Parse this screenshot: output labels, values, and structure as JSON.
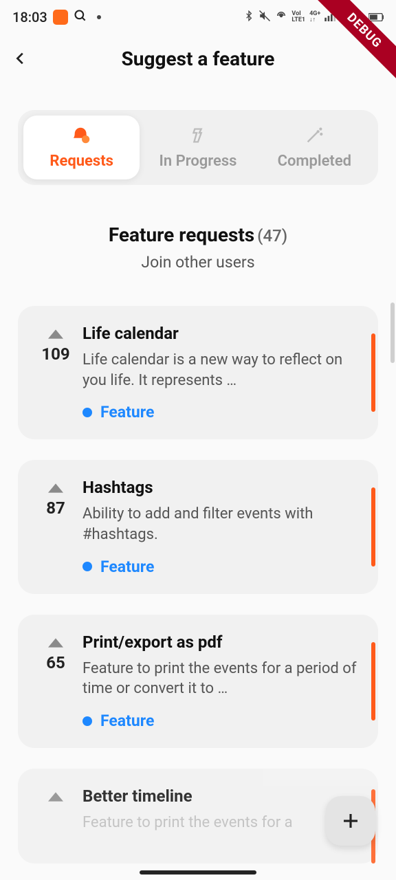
{
  "status": {
    "time": "18:03",
    "battery": "61%"
  },
  "debug_banner": "DEBUG",
  "header": {
    "title": "Suggest a feature"
  },
  "tabs": {
    "items": [
      {
        "label": "Requests"
      },
      {
        "label": "In Progress"
      },
      {
        "label": "Completed"
      }
    ],
    "active_index": 0
  },
  "section": {
    "title": "Feature requests",
    "count": "(47)",
    "subtitle": "Join other users"
  },
  "tag": {
    "label": "Feature"
  },
  "requests": [
    {
      "votes": "109",
      "title": "Life calendar",
      "desc": "Life calendar is a new way to reflect on you life. It represents …"
    },
    {
      "votes": "87",
      "title": "Hashtags",
      "desc": "Ability to add and filter events with #hashtags."
    },
    {
      "votes": "65",
      "title": "Print/export as pdf",
      "desc": "Feature to print the events for a period of time or convert it to …"
    },
    {
      "votes": "",
      "title": "Better timeline",
      "desc": "Feature to print the events for a"
    }
  ]
}
